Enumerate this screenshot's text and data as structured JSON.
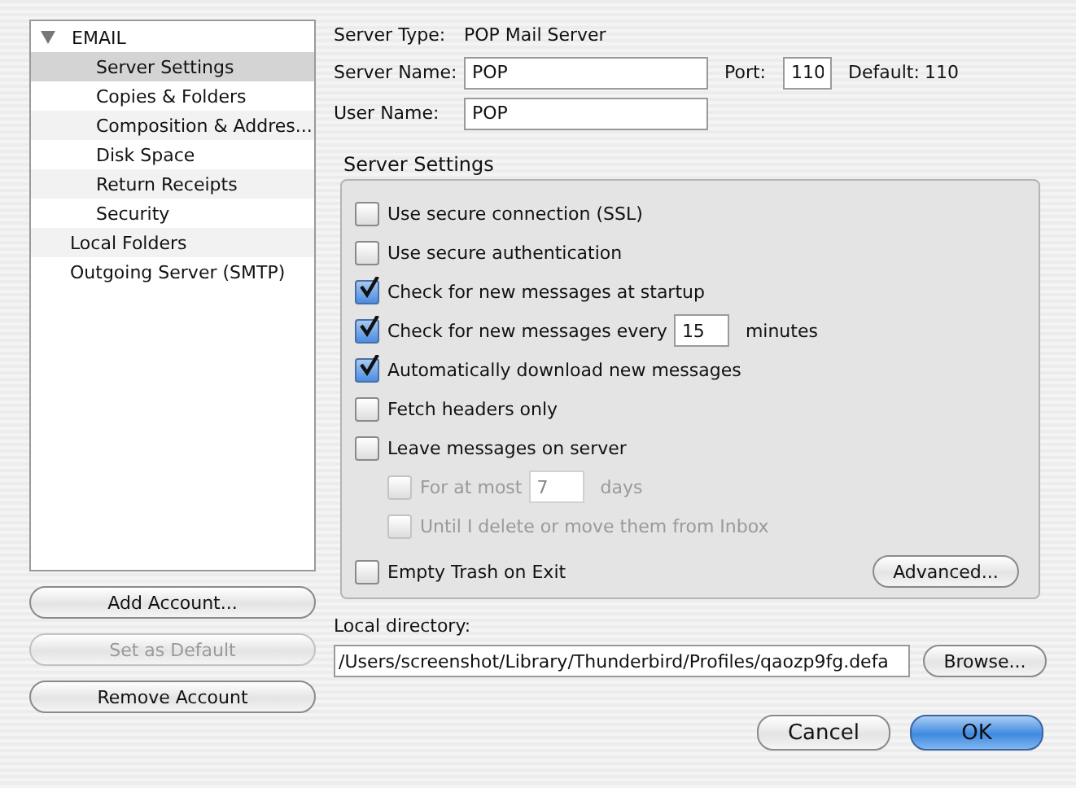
{
  "sidebar": {
    "tree": [
      {
        "label": "EMAIL",
        "expanded": true,
        "selected": false,
        "children": [
          {
            "label": "Server Settings",
            "selected": true
          },
          {
            "label": "Copies & Folders",
            "selected": false
          },
          {
            "label": "Composition & Addres...",
            "selected": false
          },
          {
            "label": "Disk Space",
            "selected": false
          },
          {
            "label": "Return Receipts",
            "selected": false
          },
          {
            "label": "Security",
            "selected": false
          }
        ]
      },
      {
        "label": "Local Folders",
        "selected": false
      },
      {
        "label": "Outgoing Server (SMTP)",
        "selected": false
      }
    ],
    "buttons": [
      {
        "label": "Add Account...",
        "disabled": false
      },
      {
        "label": "Set as Default",
        "disabled": true
      },
      {
        "label": "Remove Account",
        "disabled": false
      }
    ]
  },
  "server_type": {
    "label": "Server Type:",
    "value": "POP Mail Server"
  },
  "server_name": {
    "label": "Server Name:",
    "value": "POP"
  },
  "port": {
    "label": "Port:",
    "value": "110"
  },
  "default_port": {
    "label": "Default:",
    "value": "110"
  },
  "user_name": {
    "label": "User Name:",
    "value": "POP"
  },
  "server_settings": {
    "title": "Server Settings",
    "options": [
      {
        "kind": "checkbox",
        "label": "Use secure connection (SSL)",
        "checked": false,
        "disabled": false
      },
      {
        "kind": "checkbox",
        "label": "Use secure authentication",
        "checked": false,
        "disabled": false
      },
      {
        "kind": "checkbox",
        "label": "Check for new messages at startup",
        "checked": true,
        "disabled": false
      },
      {
        "kind": "number",
        "label": "Check for new messages every",
        "value": "15",
        "unit": "minutes",
        "checked": true,
        "disabled": false
      },
      {
        "kind": "checkbox",
        "label": "Automatically download new messages",
        "checked": true,
        "disabled": false
      },
      {
        "kind": "checkbox",
        "label": "Fetch headers only",
        "checked": false,
        "disabled": false
      },
      {
        "kind": "checkbox",
        "label": "Leave messages on server",
        "checked": false,
        "disabled": false,
        "children": [
          {
            "kind": "number",
            "label": "For at most",
            "value": "7",
            "unit": "days",
            "checked": false,
            "disabled": true
          },
          {
            "kind": "checkbox",
            "label": "Until I delete or move them from Inbox",
            "checked": false,
            "disabled": true
          }
        ]
      }
    ],
    "empty_trash": {
      "label": "Empty Trash on Exit",
      "checked": false
    },
    "advanced_button": "Advanced..."
  },
  "local_directory": {
    "label": "Local directory:",
    "value": "/Users/screenshot/Library/Thunderbird/Profiles/qaozp9fg.defa"
  },
  "browse_button": "Browse...",
  "dialog_buttons": [
    {
      "label": "Cancel",
      "default": false
    },
    {
      "label": "OK",
      "default": true
    }
  ]
}
